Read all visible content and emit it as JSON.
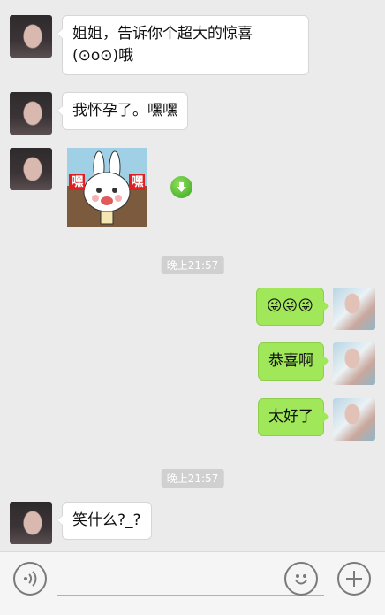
{
  "messages": [
    {
      "text": "姐姐，告诉你个超大的惊喜(⊙o⊙)哦"
    },
    {
      "text": "我怀孕了。嘿嘿"
    },
    {
      "sticker_label_left": "嘿",
      "sticker_label_right": "嘿"
    },
    {
      "text": "😜😜😜"
    },
    {
      "text": "恭喜啊"
    },
    {
      "text": "太好了"
    },
    {
      "text": "笑什么?_?"
    }
  ],
  "timestamps": [
    "晚上21:57",
    "晚上21:57"
  ],
  "input": {
    "placeholder": ""
  },
  "colors": {
    "outgoing_bubble": "#a0e75a",
    "incoming_bubble": "#ffffff",
    "background": "#ebebeb"
  }
}
